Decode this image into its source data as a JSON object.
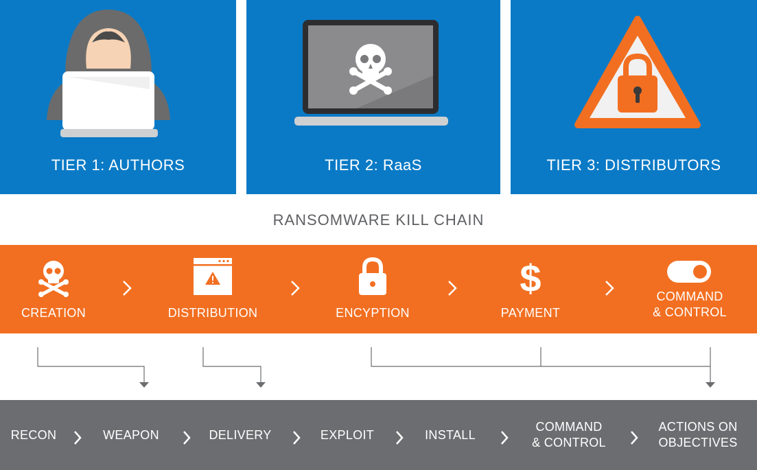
{
  "tiers": [
    {
      "label": "TIER 1: AUTHORS",
      "icon": "hooded-hacker-icon"
    },
    {
      "label": "TIER 2: RaaS",
      "icon": "laptop-skull-icon"
    },
    {
      "label": "TIER 3: DISTRIBUTORS",
      "icon": "warning-lock-icon"
    }
  ],
  "kill_chain_title": "RANSOMWARE KILL CHAIN",
  "ransomware_steps": [
    {
      "label": "CREATION",
      "icon": "skull-crossbones-icon"
    },
    {
      "label": "DISTRIBUTION",
      "icon": "browser-warning-icon"
    },
    {
      "label": "ENCYPTION",
      "icon": "padlock-icon"
    },
    {
      "label": "PAYMENT",
      "icon": "dollar-icon"
    },
    {
      "label": "COMMAND\n& CONTROL",
      "icon": "toggle-icon"
    }
  ],
  "cyber_kill_chain": [
    {
      "label": "RECON"
    },
    {
      "label": "WEAPON"
    },
    {
      "label": "DELIVERY"
    },
    {
      "label": "EXPLOIT"
    },
    {
      "label": "INSTALL"
    },
    {
      "label": "COMMAND\n& CONTROL"
    },
    {
      "label": "ACTIONS ON\nOBJECTIVES"
    }
  ],
  "colors": {
    "tier_blue": "#0a7ac6",
    "orange": "#f26f21",
    "gray": "#6c6d70",
    "title_gray": "#5f6063"
  }
}
